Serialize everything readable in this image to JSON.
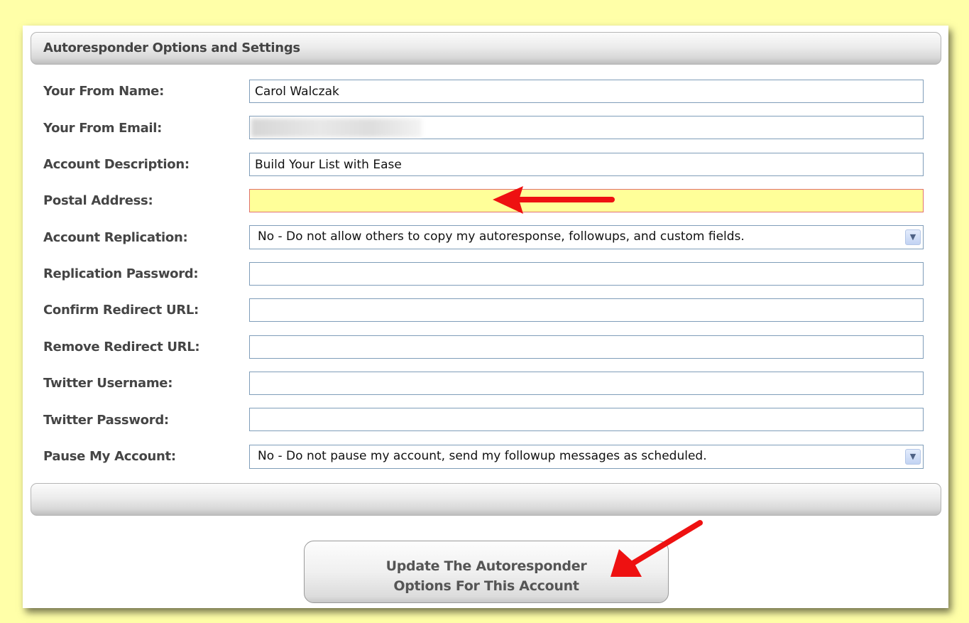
{
  "header": {
    "title": "Autoresponder Options and Settings"
  },
  "fields": {
    "from_name": {
      "label": "Your From Name:",
      "value": "Carol Walczak"
    },
    "from_email": {
      "label": "Your From Email:",
      "value": ""
    },
    "account_description": {
      "label": "Account Description:",
      "value": "Build Your List with Ease"
    },
    "postal_address": {
      "label": "Postal Address:",
      "value": ""
    },
    "account_replication": {
      "label": "Account Replication:",
      "selected": "No - Do not allow others to copy my autoresponse, followups, and custom fields."
    },
    "replication_password": {
      "label": "Replication Password:",
      "value": ""
    },
    "confirm_redirect_url": {
      "label": "Confirm Redirect URL:",
      "value": ""
    },
    "remove_redirect_url": {
      "label": "Remove Redirect URL:",
      "value": ""
    },
    "twitter_username": {
      "label": "Twitter Username:",
      "value": ""
    },
    "twitter_password": {
      "label": "Twitter Password:",
      "value": ""
    },
    "pause_account": {
      "label": "Pause My Account:",
      "selected": "No - Do not pause my account, send my followup messages as scheduled."
    }
  },
  "update_button": {
    "line1": "Update The Autoresponder",
    "line2": "Options For This Account"
  },
  "colors": {
    "page_background": "#ffffa8",
    "highlight_field": "#ffff99",
    "annotation_arrow": "#ee1111"
  },
  "icons": {
    "select_arrow": "chevron-down-icon",
    "annotation": "red-arrow-icon"
  }
}
